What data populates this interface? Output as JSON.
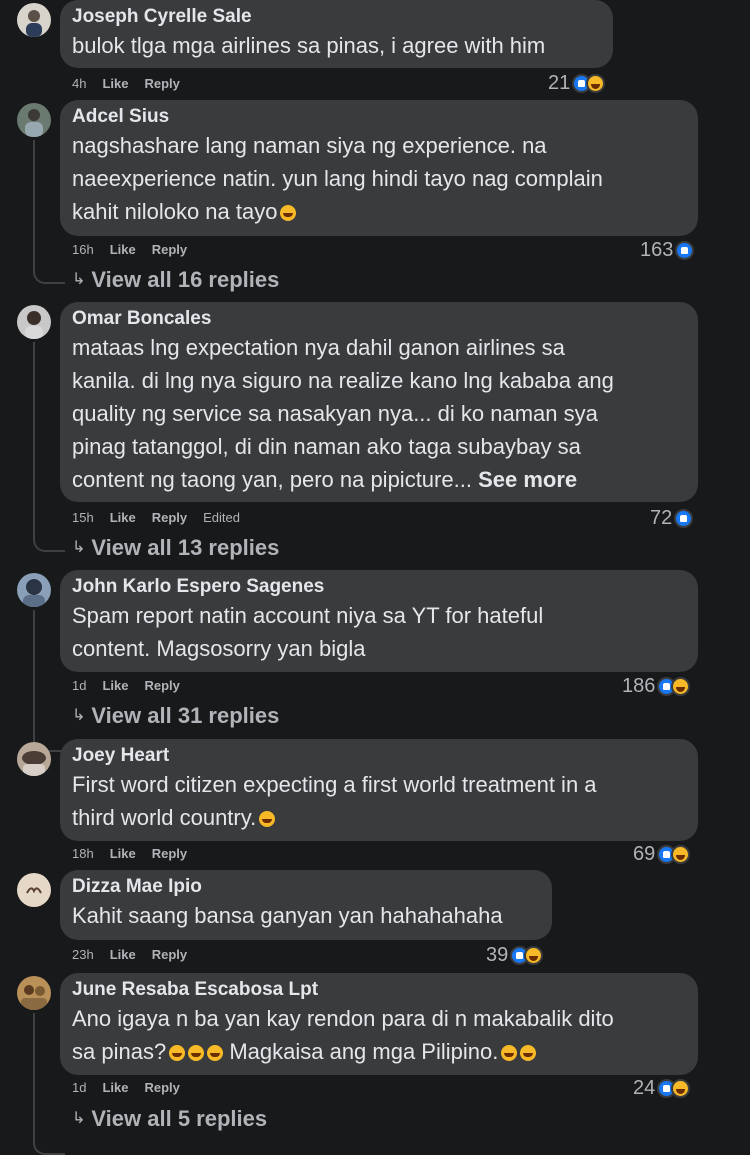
{
  "comments": [
    {
      "name": "Joseph Cyrelle Sale",
      "text": "bulok tlga mga airlines sa pinas, i agree with him",
      "time": "4h",
      "like": "Like",
      "reply": "Reply",
      "reactions": "21",
      "reaction_icons": [
        "like-icon",
        "haha-icon"
      ]
    },
    {
      "name": "Adcel Sius",
      "text_lines": [
        "nagshashare lang naman siya ng experience. na",
        "naeexperience natin. yun lang hindi tayo nag complain",
        "kahit nilolok​o na tayo"
      ],
      "time": "16h",
      "like": "Like",
      "reply": "Reply",
      "reactions": "163",
      "reaction_icons": [
        "like-icon"
      ],
      "view_replies": "View all 16 replies"
    },
    {
      "name": "Omar Boncales",
      "text_lines": [
        "mataas lng expectation nya dahil ganon airlines sa",
        "kanila. di lng nya siguro na realize kano lng kababa ang",
        "quality ng service sa nasakyan nya... di ko naman sya",
        "pinag tatanggol, di din naman ako taga subaybay sa",
        "content ng taong yan, pero na pipicture..."
      ],
      "see_more": "See more",
      "time": "15h",
      "like": "Like",
      "reply": "Reply",
      "edited": "Edited",
      "reactions": "72",
      "reaction_icons": [
        "like-icon"
      ],
      "view_replies": "View all 13 replies"
    },
    {
      "name": "John Karlo Espero Sagenes",
      "text_lines": [
        "Spam report natin account niya sa YT for hateful",
        "content. Magsosorry yan bigla"
      ],
      "time": "1d",
      "like": "Like",
      "reply": "Reply",
      "reactions": "186",
      "reaction_icons": [
        "like-icon",
        "haha-icon"
      ],
      "view_replies": "View all 31 replies"
    },
    {
      "name": "Joey Heart",
      "text_lines": [
        "First word citizen expecting a first world treatment in a",
        "third world country."
      ],
      "time": "18h",
      "like": "Like",
      "reply": "Reply",
      "reactions": "69",
      "reaction_icons": [
        "like-icon",
        "haha-icon"
      ]
    },
    {
      "name": "Dizza Mae Ipio",
      "text": "Kahit saang bansa ganyan yan hahahahaha",
      "time": "23h",
      "like": "Like",
      "reply": "Reply",
      "reactions": "39",
      "reaction_icons": [
        "like-icon",
        "haha-icon"
      ]
    },
    {
      "name": "June Resaba Escabosa Lpt",
      "text_lines": [
        "Ano igaya n ba yan kay rendon para di n makabalik dito",
        "sa pinas?",
        "Magkaisa ang mga Pilipino."
      ],
      "time": "1d",
      "like": "Like",
      "reply": "Reply",
      "reactions": "24",
      "reaction_icons": [
        "like-icon",
        "haha-icon"
      ],
      "view_replies": "View all 5 replies"
    }
  ],
  "colors": {
    "background": "#18191a",
    "bubble": "#3a3b3c",
    "text": "#e4e6eb",
    "secondary": "#b0b3b8",
    "like": "#1877f2",
    "haha": "#f7b928"
  }
}
